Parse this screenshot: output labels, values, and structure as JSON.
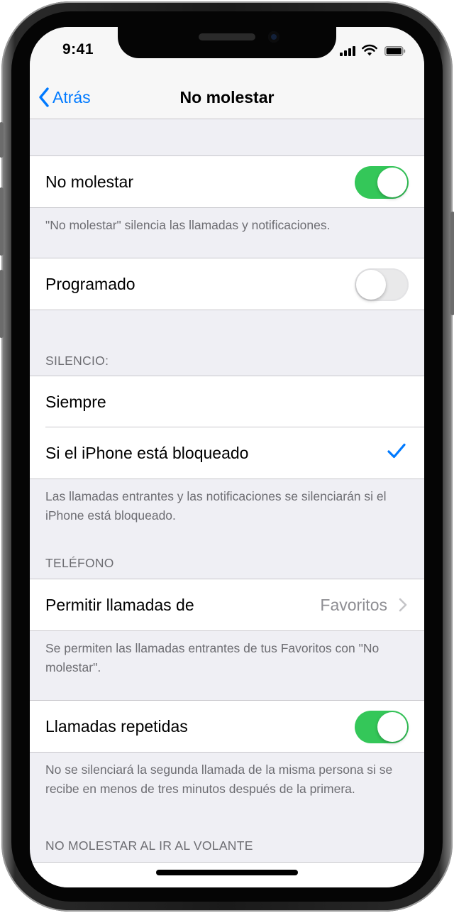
{
  "status": {
    "time": "9:41"
  },
  "nav": {
    "back_label": "Atrás",
    "title": "No molestar"
  },
  "dnd": {
    "label": "No molestar",
    "on": true,
    "footer": "\"No molestar\" silencia las llamadas y notificaciones."
  },
  "scheduled": {
    "label": "Programado",
    "on": false
  },
  "silence": {
    "header": "SILENCIO:",
    "items": [
      {
        "label": "Siempre",
        "checked": false
      },
      {
        "label": "Si el iPhone está bloqueado",
        "checked": true
      }
    ],
    "footer": "Las llamadas entrantes y las notificaciones se silenciarán si el iPhone está bloqueado."
  },
  "phone": {
    "header": "TELÉFONO",
    "allow_label": "Permitir llamadas de",
    "allow_value": "Favoritos",
    "footer": "Se permiten las llamadas entrantes de tus Favoritos con \"No molestar\"."
  },
  "repeated": {
    "label": "Llamadas repetidas",
    "on": true,
    "footer": "No se silenciará la segunda llamada de la misma persona si se recibe en menos de tres minutos después de la primera."
  },
  "driving": {
    "header": "NO MOLESTAR AL IR AL VOLANTE"
  },
  "colors": {
    "accent": "#007aff",
    "toggle_on": "#34c759",
    "background": "#efeff4",
    "footer_text": "#6d6d72"
  }
}
